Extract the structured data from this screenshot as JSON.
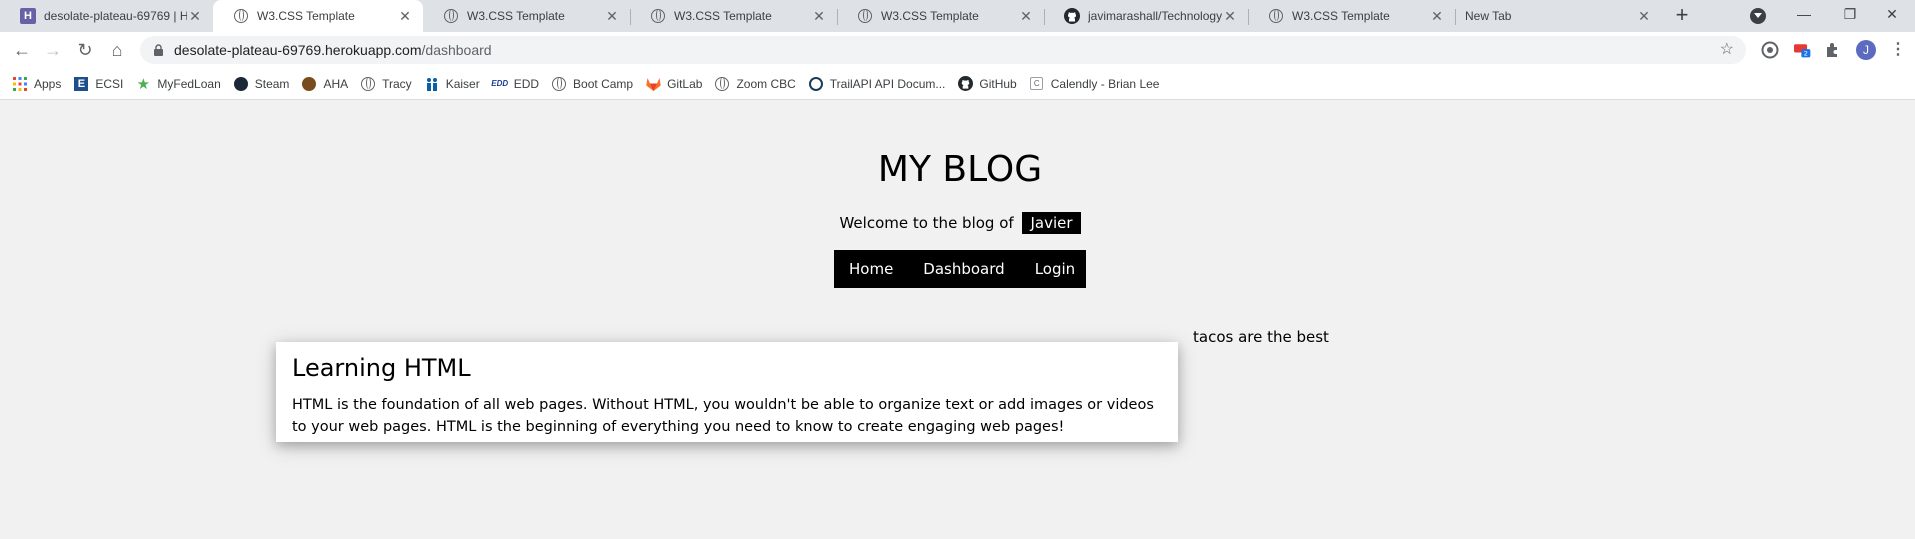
{
  "tabs": [
    {
      "title": "desolate-plateau-69769 | H",
      "icon": "heroku-icon",
      "active": false
    },
    {
      "title": "W3.CSS Template",
      "icon": "globe-icon",
      "active": true
    },
    {
      "title": "W3.CSS Template",
      "icon": "globe-icon",
      "active": false
    },
    {
      "title": "W3.CSS Template",
      "icon": "globe-icon",
      "active": false
    },
    {
      "title": "W3.CSS Template",
      "icon": "globe-icon",
      "active": false
    },
    {
      "title": "javimarashall/Technology-",
      "icon": "github-icon",
      "active": false
    },
    {
      "title": "W3.CSS Template",
      "icon": "globe-icon",
      "active": false
    },
    {
      "title": "New Tab",
      "icon": "",
      "active": false
    }
  ],
  "tab_icon_letter": "H",
  "toolbar": {
    "url_host": "desolate-plateau-69769.herokuapp.com",
    "url_path": "/dashboard",
    "profile_initial": "J",
    "extension_badge": "2"
  },
  "bookmarks": [
    {
      "label": "Apps",
      "icon": "apps-grid-icon"
    },
    {
      "label": "ECSI",
      "icon": "ecsi-icon"
    },
    {
      "label": "MyFedLoan",
      "icon": "myfedloan-icon"
    },
    {
      "label": "Steam",
      "icon": "steam-icon"
    },
    {
      "label": "AHA",
      "icon": "aha-icon"
    },
    {
      "label": "Tracy",
      "icon": "globe-icon"
    },
    {
      "label": "Kaiser",
      "icon": "kaiser-icon"
    },
    {
      "label": "EDD",
      "icon": "edd-icon"
    },
    {
      "label": "Boot Camp",
      "icon": "globe-icon"
    },
    {
      "label": "GitLab",
      "icon": "gitlab-icon"
    },
    {
      "label": "Zoom CBC",
      "icon": "globe-icon"
    },
    {
      "label": "TrailAPI API Docum...",
      "icon": "trailapi-icon"
    },
    {
      "label": "GitHub",
      "icon": "github-icon"
    },
    {
      "label": "Calendly - Brian Lee",
      "icon": "calendly-icon"
    }
  ],
  "bookmark_icon_text": {
    "ecsi": "E",
    "edd": "EDD",
    "calendly": "C"
  },
  "page": {
    "blog_title": "MY BLOG",
    "welcome_text": "Welcome to the blog of",
    "username": "Javier",
    "nav": [
      "Home",
      "Dashboard",
      "Login"
    ],
    "post": {
      "title": "Learning HTML",
      "body": "HTML is the foundation of all web pages. Without HTML, you wouldn't be able to organize text or add images or videos to your web pages. HTML is the beginning of everything you need to know to create engaging web pages!"
    },
    "aside_text": "tacos are the best"
  }
}
